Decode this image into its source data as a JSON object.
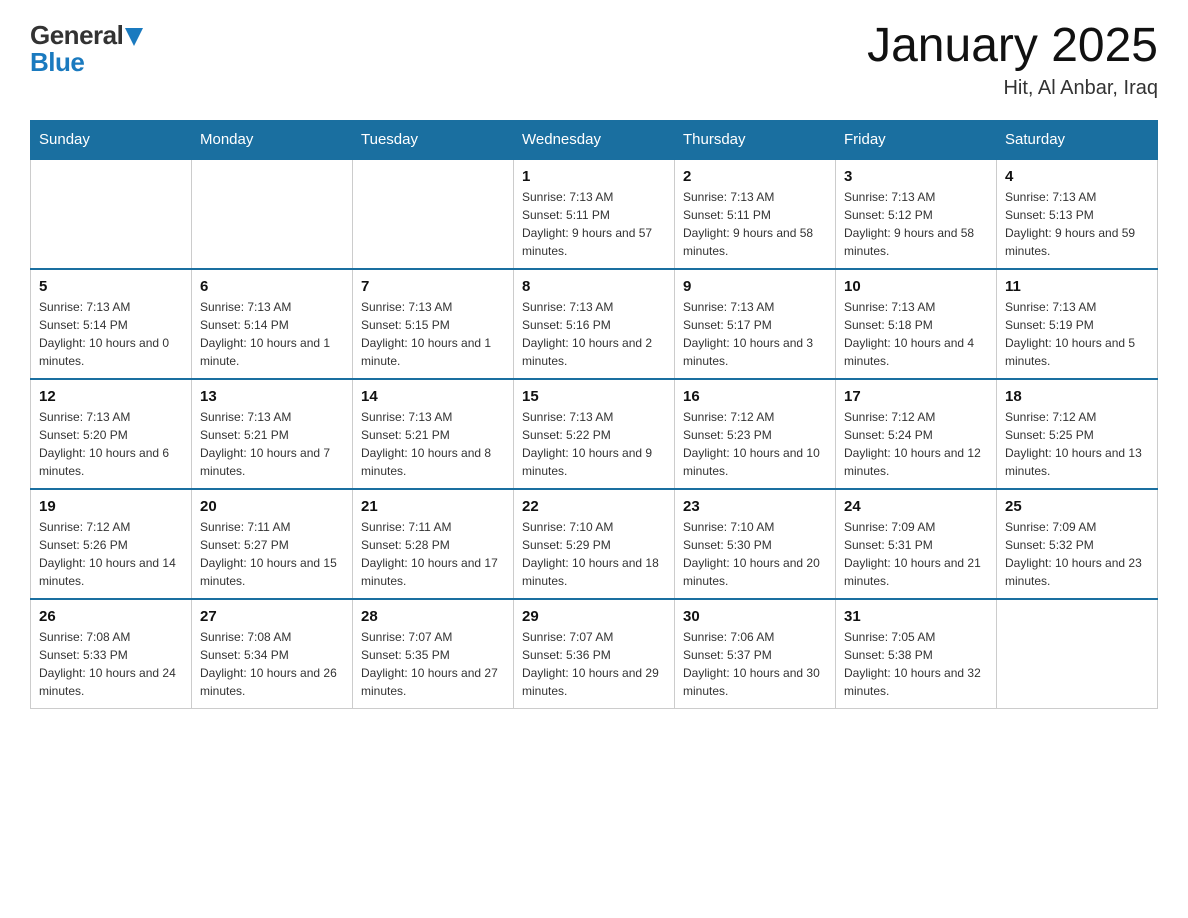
{
  "header": {
    "logo_general": "General",
    "logo_blue": "Blue",
    "title": "January 2025",
    "subtitle": "Hit, Al Anbar, Iraq"
  },
  "weekdays": [
    "Sunday",
    "Monday",
    "Tuesday",
    "Wednesday",
    "Thursday",
    "Friday",
    "Saturday"
  ],
  "weeks": [
    [
      {
        "day": "",
        "sunrise": "",
        "sunset": "",
        "daylight": ""
      },
      {
        "day": "",
        "sunrise": "",
        "sunset": "",
        "daylight": ""
      },
      {
        "day": "",
        "sunrise": "",
        "sunset": "",
        "daylight": ""
      },
      {
        "day": "1",
        "sunrise": "Sunrise: 7:13 AM",
        "sunset": "Sunset: 5:11 PM",
        "daylight": "Daylight: 9 hours and 57 minutes."
      },
      {
        "day": "2",
        "sunrise": "Sunrise: 7:13 AM",
        "sunset": "Sunset: 5:11 PM",
        "daylight": "Daylight: 9 hours and 58 minutes."
      },
      {
        "day": "3",
        "sunrise": "Sunrise: 7:13 AM",
        "sunset": "Sunset: 5:12 PM",
        "daylight": "Daylight: 9 hours and 58 minutes."
      },
      {
        "day": "4",
        "sunrise": "Sunrise: 7:13 AM",
        "sunset": "Sunset: 5:13 PM",
        "daylight": "Daylight: 9 hours and 59 minutes."
      }
    ],
    [
      {
        "day": "5",
        "sunrise": "Sunrise: 7:13 AM",
        "sunset": "Sunset: 5:14 PM",
        "daylight": "Daylight: 10 hours and 0 minutes."
      },
      {
        "day": "6",
        "sunrise": "Sunrise: 7:13 AM",
        "sunset": "Sunset: 5:14 PM",
        "daylight": "Daylight: 10 hours and 1 minute."
      },
      {
        "day": "7",
        "sunrise": "Sunrise: 7:13 AM",
        "sunset": "Sunset: 5:15 PM",
        "daylight": "Daylight: 10 hours and 1 minute."
      },
      {
        "day": "8",
        "sunrise": "Sunrise: 7:13 AM",
        "sunset": "Sunset: 5:16 PM",
        "daylight": "Daylight: 10 hours and 2 minutes."
      },
      {
        "day": "9",
        "sunrise": "Sunrise: 7:13 AM",
        "sunset": "Sunset: 5:17 PM",
        "daylight": "Daylight: 10 hours and 3 minutes."
      },
      {
        "day": "10",
        "sunrise": "Sunrise: 7:13 AM",
        "sunset": "Sunset: 5:18 PM",
        "daylight": "Daylight: 10 hours and 4 minutes."
      },
      {
        "day": "11",
        "sunrise": "Sunrise: 7:13 AM",
        "sunset": "Sunset: 5:19 PM",
        "daylight": "Daylight: 10 hours and 5 minutes."
      }
    ],
    [
      {
        "day": "12",
        "sunrise": "Sunrise: 7:13 AM",
        "sunset": "Sunset: 5:20 PM",
        "daylight": "Daylight: 10 hours and 6 minutes."
      },
      {
        "day": "13",
        "sunrise": "Sunrise: 7:13 AM",
        "sunset": "Sunset: 5:21 PM",
        "daylight": "Daylight: 10 hours and 7 minutes."
      },
      {
        "day": "14",
        "sunrise": "Sunrise: 7:13 AM",
        "sunset": "Sunset: 5:21 PM",
        "daylight": "Daylight: 10 hours and 8 minutes."
      },
      {
        "day": "15",
        "sunrise": "Sunrise: 7:13 AM",
        "sunset": "Sunset: 5:22 PM",
        "daylight": "Daylight: 10 hours and 9 minutes."
      },
      {
        "day": "16",
        "sunrise": "Sunrise: 7:12 AM",
        "sunset": "Sunset: 5:23 PM",
        "daylight": "Daylight: 10 hours and 10 minutes."
      },
      {
        "day": "17",
        "sunrise": "Sunrise: 7:12 AM",
        "sunset": "Sunset: 5:24 PM",
        "daylight": "Daylight: 10 hours and 12 minutes."
      },
      {
        "day": "18",
        "sunrise": "Sunrise: 7:12 AM",
        "sunset": "Sunset: 5:25 PM",
        "daylight": "Daylight: 10 hours and 13 minutes."
      }
    ],
    [
      {
        "day": "19",
        "sunrise": "Sunrise: 7:12 AM",
        "sunset": "Sunset: 5:26 PM",
        "daylight": "Daylight: 10 hours and 14 minutes."
      },
      {
        "day": "20",
        "sunrise": "Sunrise: 7:11 AM",
        "sunset": "Sunset: 5:27 PM",
        "daylight": "Daylight: 10 hours and 15 minutes."
      },
      {
        "day": "21",
        "sunrise": "Sunrise: 7:11 AM",
        "sunset": "Sunset: 5:28 PM",
        "daylight": "Daylight: 10 hours and 17 minutes."
      },
      {
        "day": "22",
        "sunrise": "Sunrise: 7:10 AM",
        "sunset": "Sunset: 5:29 PM",
        "daylight": "Daylight: 10 hours and 18 minutes."
      },
      {
        "day": "23",
        "sunrise": "Sunrise: 7:10 AM",
        "sunset": "Sunset: 5:30 PM",
        "daylight": "Daylight: 10 hours and 20 minutes."
      },
      {
        "day": "24",
        "sunrise": "Sunrise: 7:09 AM",
        "sunset": "Sunset: 5:31 PM",
        "daylight": "Daylight: 10 hours and 21 minutes."
      },
      {
        "day": "25",
        "sunrise": "Sunrise: 7:09 AM",
        "sunset": "Sunset: 5:32 PM",
        "daylight": "Daylight: 10 hours and 23 minutes."
      }
    ],
    [
      {
        "day": "26",
        "sunrise": "Sunrise: 7:08 AM",
        "sunset": "Sunset: 5:33 PM",
        "daylight": "Daylight: 10 hours and 24 minutes."
      },
      {
        "day": "27",
        "sunrise": "Sunrise: 7:08 AM",
        "sunset": "Sunset: 5:34 PM",
        "daylight": "Daylight: 10 hours and 26 minutes."
      },
      {
        "day": "28",
        "sunrise": "Sunrise: 7:07 AM",
        "sunset": "Sunset: 5:35 PM",
        "daylight": "Daylight: 10 hours and 27 minutes."
      },
      {
        "day": "29",
        "sunrise": "Sunrise: 7:07 AM",
        "sunset": "Sunset: 5:36 PM",
        "daylight": "Daylight: 10 hours and 29 minutes."
      },
      {
        "day": "30",
        "sunrise": "Sunrise: 7:06 AM",
        "sunset": "Sunset: 5:37 PM",
        "daylight": "Daylight: 10 hours and 30 minutes."
      },
      {
        "day": "31",
        "sunrise": "Sunrise: 7:05 AM",
        "sunset": "Sunset: 5:38 PM",
        "daylight": "Daylight: 10 hours and 32 minutes."
      },
      {
        "day": "",
        "sunrise": "",
        "sunset": "",
        "daylight": ""
      }
    ]
  ]
}
